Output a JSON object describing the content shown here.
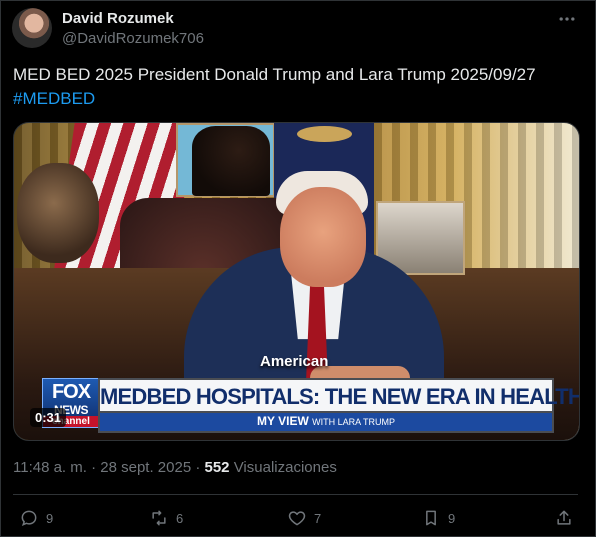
{
  "author": {
    "display_name": "David Rozumek",
    "handle": "@DavidRozumek706"
  },
  "tweet": {
    "text": "MED BED 2025 President Donald Trump and Lara Trump 2025/09/27 ",
    "hashtag": "#MEDBED"
  },
  "video": {
    "channel_name": "FOX NEWS",
    "channel_sub": "channel",
    "headline": "MEDBED HOSPITALS: THE NEW ERA IN HEALTHCARE",
    "subheadline_main": "MY VIEW",
    "subheadline_small": "WITH LARA TRUMP",
    "spoken_caption": "American",
    "duration": "0:31"
  },
  "meta": {
    "time_date": "11:48 a. m. · 28 sept. 2025 · ",
    "views_count": "552",
    "views_label": " Visualizaciones"
  },
  "actions": {
    "replies": "9",
    "reposts": "6",
    "likes": "7",
    "bookmarks": "9"
  },
  "icons": {
    "more": "more-icon",
    "reply": "reply-icon",
    "repost": "repost-icon",
    "like": "heart-icon",
    "bookmark": "bookmark-icon",
    "share": "share-icon"
  },
  "colors": {
    "background": "#000000",
    "text_primary": "#e7e9ea",
    "text_secondary": "#71767b",
    "link": "#1d9bf0",
    "border": "#2f3336"
  }
}
